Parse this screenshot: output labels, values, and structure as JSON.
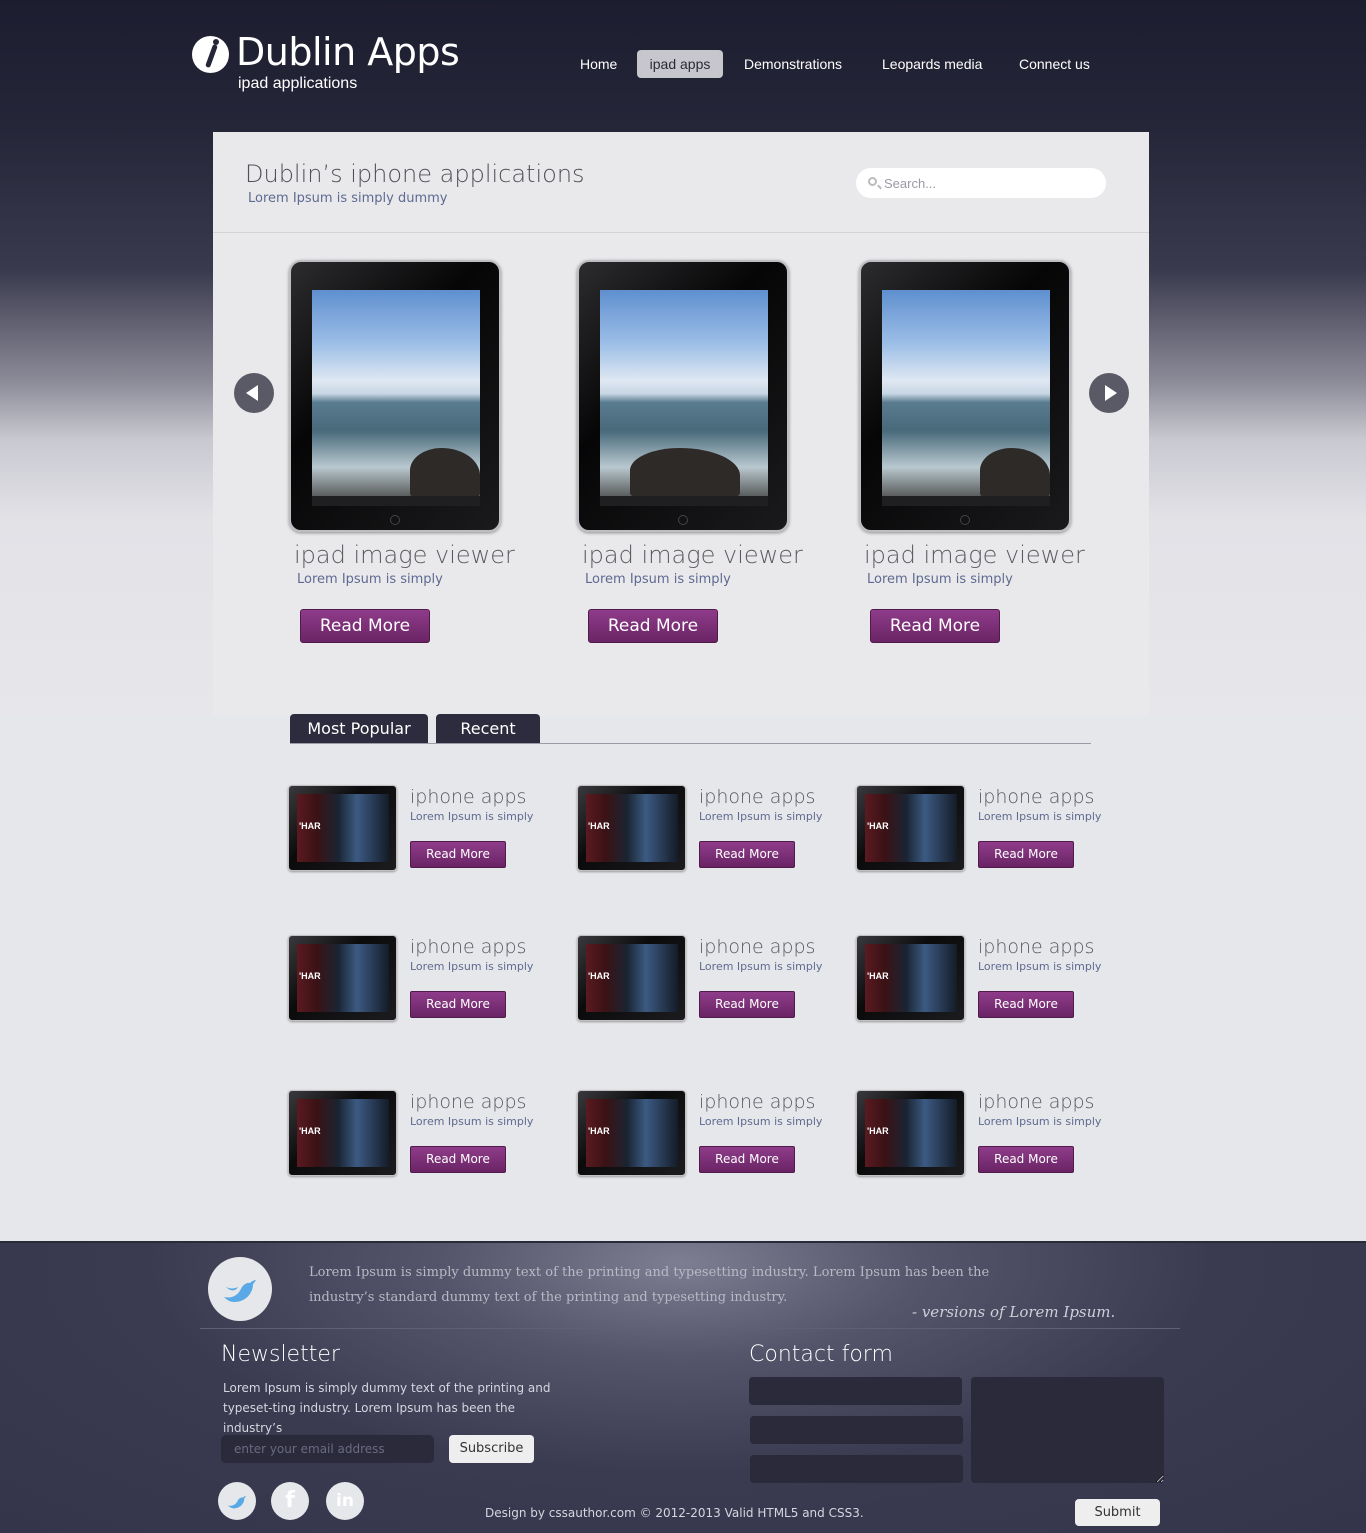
{
  "header": {
    "logo_icon": "info-i-icon",
    "title": "Dublin Apps",
    "subtitle": "ipad applications",
    "nav": [
      {
        "label": "Home",
        "active": false
      },
      {
        "label": "ipad apps",
        "active": true
      },
      {
        "label": "Demonstrations",
        "active": false
      },
      {
        "label": "Leopards media",
        "active": false
      },
      {
        "label": "Connect us",
        "active": false
      }
    ]
  },
  "panel": {
    "title": "Dublin’s iphone applications",
    "subtitle": "Lorem Ipsum is simply dummy",
    "search_placeholder": "Search...",
    "search_icon": "search-icon",
    "prev_icon": "arrow-left-icon",
    "next_icon": "arrow-right-icon"
  },
  "featured": [
    {
      "title": "ipad image viewer",
      "subtitle": "Lorem Ipsum is simply",
      "button": "Read More"
    },
    {
      "title": "ipad image viewer",
      "subtitle": "Lorem Ipsum is simply",
      "button": "Read More"
    },
    {
      "title": "ipad image viewer",
      "subtitle": "Lorem Ipsum is simply",
      "button": "Read More"
    }
  ],
  "tabs": [
    {
      "label": "Most Popular",
      "active": true
    },
    {
      "label": "Recent",
      "active": false
    }
  ],
  "apps": [
    {
      "title": "iphone apps",
      "subtitle": "Lorem Ipsum is simply",
      "button": "Read More"
    },
    {
      "title": "iphone apps",
      "subtitle": "Lorem Ipsum is simply",
      "button": "Read More"
    },
    {
      "title": "iphone apps",
      "subtitle": "Lorem Ipsum is simply",
      "button": "Read More"
    },
    {
      "title": "iphone apps",
      "subtitle": "Lorem Ipsum is simply",
      "button": "Read More"
    },
    {
      "title": "iphone apps",
      "subtitle": "Lorem Ipsum is simply",
      "button": "Read More"
    },
    {
      "title": "iphone apps",
      "subtitle": "Lorem Ipsum is simply",
      "button": "Read More"
    },
    {
      "title": "iphone apps",
      "subtitle": "Lorem Ipsum is simply",
      "button": "Read More"
    },
    {
      "title": "iphone apps",
      "subtitle": "Lorem Ipsum is simply",
      "button": "Read More"
    },
    {
      "title": "iphone apps",
      "subtitle": "Lorem Ipsum is simply",
      "button": "Read More"
    }
  ],
  "footer": {
    "twitter_icon": "twitter-bird-icon",
    "quote": "Lorem Ipsum is simply dummy text of the printing and typesetting industry. Lorem Ipsum has been the industry’s standard dummy text  of the printing and typesetting industry.",
    "quote_by": "- versions of Lorem Ipsum.",
    "newsletter_title": "Newsletter",
    "newsletter_text": "Lorem Ipsum is simply dummy text of the printing and typeset-ting industry. Lorem Ipsum has been the industry’s",
    "email_placeholder": "enter your email address",
    "subscribe": "Subscribe",
    "social": [
      "twitter-icon",
      "facebook-icon",
      "linkedin-icon"
    ],
    "contact_title": "Contact form",
    "submit": "Submit",
    "credit": "Design by cssauthor.com © 2012-2013  Valid HTML5 and CSS3."
  },
  "colors": {
    "header_bg": "#262639",
    "button_purple": "#7a2e75",
    "link_blue": "#5e6a90",
    "tab_bg": "#2c2c3e",
    "footer_bg": "#3a3a50"
  }
}
